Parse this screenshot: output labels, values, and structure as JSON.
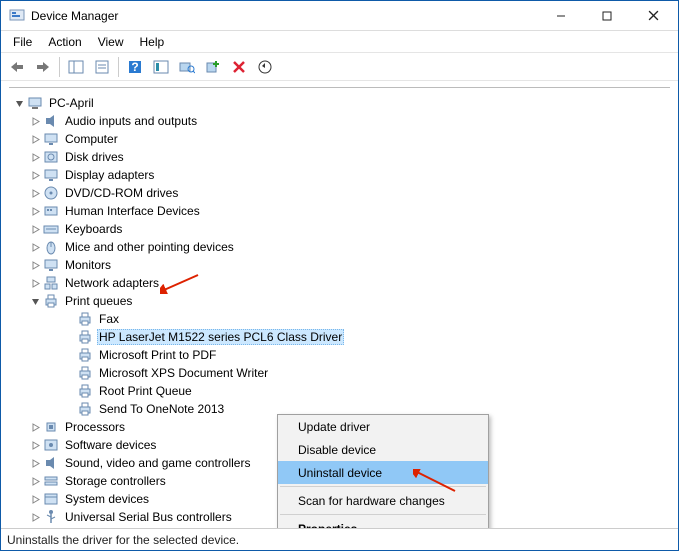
{
  "window": {
    "title": "Device Manager"
  },
  "menu": {
    "file": "File",
    "action": "Action",
    "view": "View",
    "help": "Help"
  },
  "tree": {
    "root": "PC-April",
    "items": [
      {
        "label": "Audio inputs and outputs",
        "icon": "speaker"
      },
      {
        "label": "Computer",
        "icon": "monitor"
      },
      {
        "label": "Disk drives",
        "icon": "disk"
      },
      {
        "label": "Display adapters",
        "icon": "monitor"
      },
      {
        "label": "DVD/CD-ROM drives",
        "icon": "disc"
      },
      {
        "label": "Human Interface Devices",
        "icon": "hid"
      },
      {
        "label": "Keyboards",
        "icon": "keyboard"
      },
      {
        "label": "Mice and other pointing devices",
        "icon": "mouse"
      },
      {
        "label": "Monitors",
        "icon": "monitor"
      },
      {
        "label": "Network adapters",
        "icon": "network"
      },
      {
        "label": "Print queues",
        "icon": "printer",
        "expanded": true
      },
      {
        "label": "Processors",
        "icon": "cpu"
      },
      {
        "label": "Software devices",
        "icon": "software"
      },
      {
        "label": "Sound, video and game controllers",
        "icon": "speaker"
      },
      {
        "label": "Storage controllers",
        "icon": "storage"
      },
      {
        "label": "System devices",
        "icon": "system"
      },
      {
        "label": "Universal Serial Bus controllers",
        "icon": "usb"
      }
    ],
    "print_children": [
      {
        "label": "Fax"
      },
      {
        "label": "HP LaserJet M1522 series PCL6 Class Driver",
        "selected": true
      },
      {
        "label": "Microsoft Print to PDF"
      },
      {
        "label": "Microsoft XPS Document Writer"
      },
      {
        "label": "Root Print Queue"
      },
      {
        "label": "Send To OneNote 2013"
      }
    ]
  },
  "context_menu": {
    "update": "Update driver",
    "disable": "Disable device",
    "uninstall": "Uninstall device",
    "scan": "Scan for hardware changes",
    "properties": "Properties"
  },
  "statusbar": {
    "text": "Uninstalls the driver for the selected device."
  }
}
